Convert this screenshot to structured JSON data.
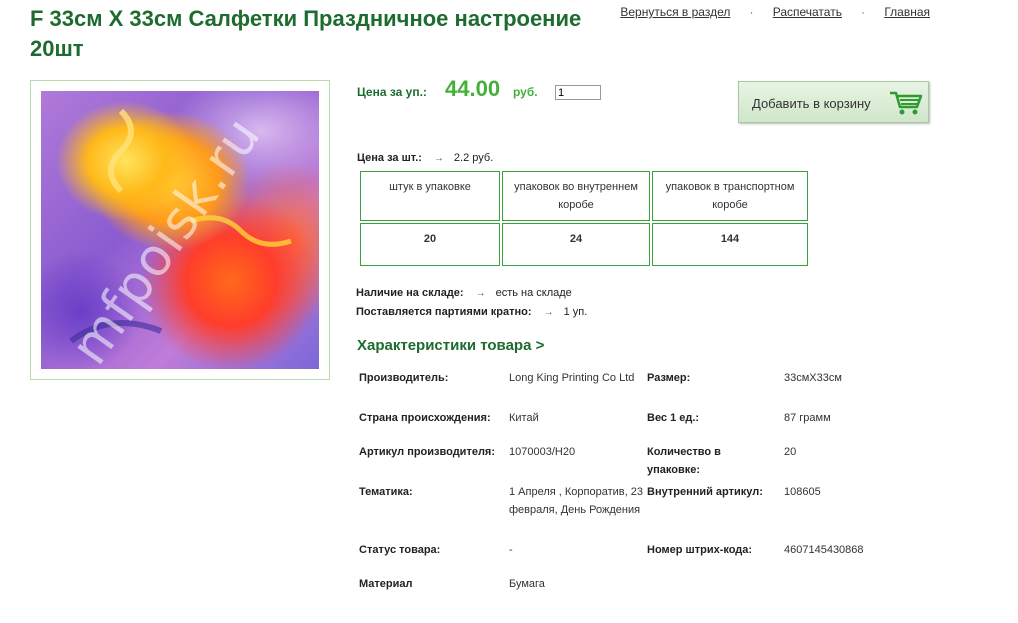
{
  "title": "F 33см X 33см Салфетки Праздничное настроение 20шт",
  "nav": {
    "back": "Вернуться в раздел",
    "print": "Распечатать",
    "home": "Главная",
    "separator": "·"
  },
  "photo": {
    "watermark": "mfpoisk.ru"
  },
  "price": {
    "label": "Цена за уп.:",
    "value": "44.00",
    "currency": "руб.",
    "quantity": "1"
  },
  "cart_button": {
    "label": "Добавить в корзину",
    "icon": "shopping-cart-icon"
  },
  "unit_price": {
    "label": "Цена за шт.:",
    "arrow": "→",
    "value": "2.2 руб."
  },
  "packaging": {
    "headers": [
      "штук в упаковке",
      "упаковок во внутреннем коробе",
      "упаковок в транспортном коробе"
    ],
    "values": [
      "20",
      "24",
      "144"
    ]
  },
  "stock": {
    "availability_label": "Наличие на складе:",
    "availability_value": "есть на складе",
    "batch_label": "Поставляется партиями кратно:",
    "batch_value": "1 уп."
  },
  "specs": {
    "title": "Характеристики товара >",
    "left": [
      {
        "key": "Производитель:",
        "value": "Long King Printing Co Ltd"
      },
      {
        "key": "Страна происхождения:",
        "value": "Китай"
      },
      {
        "key": "Артикул производителя:",
        "value": "1070003/H20"
      },
      {
        "key": "Тематика:",
        "value": "1 Апреля , Корпоратив, 23 февраля, День Рождения"
      },
      {
        "key": "Статус товара:",
        "value": "-"
      },
      {
        "key": "Материал",
        "value": "Бумага"
      }
    ],
    "right": [
      {
        "key": "Размер:",
        "value": "33смХ33см"
      },
      {
        "key": "Вес 1 ед.:",
        "value": "87 грамм"
      },
      {
        "key": "Количество в упаковке:",
        "value": "20"
      },
      {
        "key": "Внутренний артикул:",
        "value": "108605"
      },
      {
        "key": "Номер штрих-кода:",
        "value": "4607145430868"
      }
    ]
  },
  "colors": {
    "brand_green": "#1d6b2f",
    "price_green": "#44b03a",
    "table_border": "#3aa23a"
  }
}
